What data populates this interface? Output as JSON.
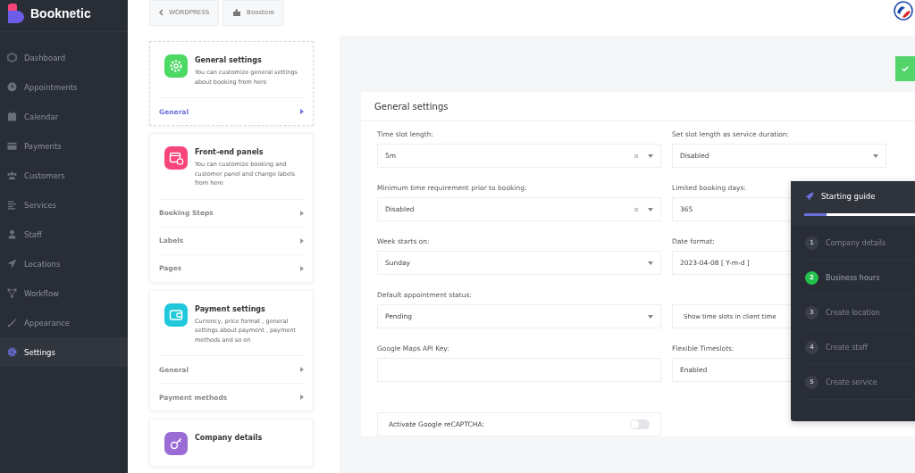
{
  "brand": {
    "name": "Booknetic"
  },
  "sidebar": {
    "items": [
      {
        "label": "Dashboard",
        "selected": false
      },
      {
        "label": "Appointments",
        "selected": false
      },
      {
        "label": "Calendar",
        "selected": false
      },
      {
        "label": "Payments",
        "selected": false
      },
      {
        "label": "Customers",
        "selected": false
      },
      {
        "label": "Services",
        "selected": false
      },
      {
        "label": "Staff",
        "selected": false
      },
      {
        "label": "Locations",
        "selected": false
      },
      {
        "label": "Workflow",
        "selected": false
      },
      {
        "label": "Appearance",
        "selected": false
      },
      {
        "label": "Settings",
        "selected": true
      }
    ]
  },
  "breadcrumbs": [
    {
      "label": "WORDPRESS"
    },
    {
      "label": "Boostore"
    }
  ],
  "settings_menu": [
    {
      "title": "General settings",
      "description": "You can customize general settings about booking from here",
      "color": "#4cd964",
      "selected": true,
      "links": [
        {
          "label": "General",
          "selected": true
        }
      ]
    },
    {
      "title": "Front-end panels",
      "description": "You can customize booking and customer panel and change labels from here",
      "color": "#f7457c",
      "selected": false,
      "links": [
        {
          "label": "Booking Steps",
          "selected": false
        },
        {
          "label": "Labels",
          "selected": false
        },
        {
          "label": "Pages",
          "selected": false
        }
      ]
    },
    {
      "title": "Payment settings",
      "description": "Currency, price format , general settings about payment , payment methods and so on",
      "color": "#1fc8db",
      "selected": false,
      "links": [
        {
          "label": "General",
          "selected": false
        },
        {
          "label": "Payment methods",
          "selected": false
        }
      ]
    },
    {
      "title": "Company details",
      "color": "#9b6bd6",
      "selected": false
    }
  ],
  "form": {
    "title": "General settings",
    "rows": [
      [
        {
          "kind": "select",
          "label": "Time slot length:",
          "value": "5m",
          "clearable": true
        },
        {
          "kind": "select",
          "label": "Set slot length as service duration:",
          "value": "Disabled",
          "clearable": false
        }
      ],
      [
        {
          "kind": "select",
          "label": "Minimum time requirement prior to booking:",
          "value": "Disabled",
          "clearable": true
        },
        {
          "kind": "text",
          "label": "Limited booking days:",
          "value": "365"
        }
      ],
      [
        {
          "kind": "select",
          "label": "Week starts on:",
          "value": "Sunday",
          "clearable": false
        },
        {
          "kind": "select",
          "label": "Date format:",
          "value": "2023-04-08 [ Y-m-d ]"
        }
      ],
      [
        {
          "kind": "select",
          "label": "Default appointment status:",
          "value": "Pending",
          "clearable": false
        },
        {
          "kind": "note",
          "text": "Show time slots in client time"
        }
      ],
      [
        {
          "kind": "text",
          "label": "Google Maps API Key:"
        },
        {
          "kind": "select",
          "label": "Flexible Timeslots:",
          "value": "Enabled"
        }
      ],
      [
        {
          "kind": "toggle",
          "text": "Activate Google reCAPTCHA:",
          "on": false
        }
      ]
    ]
  },
  "guide": {
    "title": "Starting guide",
    "level": 0.2,
    "steps": [
      {
        "number": "1",
        "label": "Company details",
        "active": false
      },
      {
        "number": "2",
        "label": "Business hours",
        "active": true
      },
      {
        "number": "3",
        "label": "Create location",
        "active": false
      },
      {
        "number": "4",
        "label": "Create staff",
        "active": false
      },
      {
        "number": "5",
        "label": "Create service",
        "active": false
      }
    ]
  }
}
